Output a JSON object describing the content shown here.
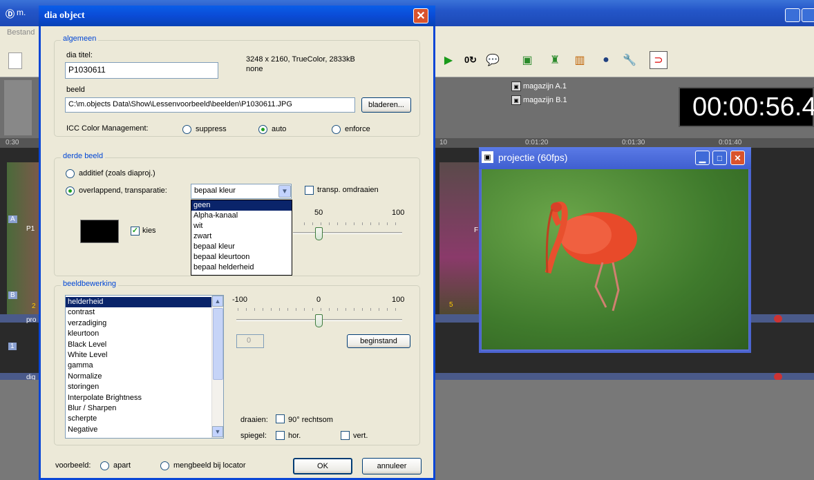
{
  "app": {
    "title": "m.",
    "menu_first": "Bestand",
    "timecode": "00:00:56.48",
    "magazines": [
      "magazijn A.1",
      "magazijn B.1"
    ],
    "ruler_labels": [
      "0:30",
      "10",
      "0:01:20",
      "0:01:30",
      "0:01:40"
    ],
    "track_labels": [
      "A",
      "B",
      "1"
    ],
    "track_texts": [
      "P1",
      "pro",
      "dig",
      "2",
      "5",
      "F"
    ]
  },
  "dialog": {
    "title": "dia object",
    "algemeen": {
      "legend": "algemeen",
      "dia_titel_label": "dia titel:",
      "dia_titel_value": "P1030611",
      "image_info": "3248 x 2160, TrueColor, 2833kB",
      "image_info2": "none",
      "beeld_label": "beeld",
      "beeld_path": "C:\\m.objects Data\\Show\\Lessenvoorbeeld\\beelden\\P1030611.JPG",
      "browse_label": "bladeren...",
      "icc_label": "ICC Color Management:",
      "icc_options": [
        "suppress",
        "auto",
        "enforce"
      ],
      "icc_selected": "auto"
    },
    "derde_beeld": {
      "legend": "derde beeld",
      "option1": "additief (zoals diaproj.)",
      "option2": "overlappend, transparatie:",
      "dropdown_value": "bepaal kleur",
      "dropdown_options": [
        "geen",
        "Alpha-kanaal",
        "wit",
        "zwart",
        "bepaal kleur",
        "bepaal kleurtoon",
        "bepaal helderheid"
      ],
      "dropdown_highlight": "geen",
      "transp_label": "transp. omdraaien",
      "kies_label": "kies",
      "swatch_color": "#000000",
      "slider_mid": "50",
      "slider_max": "100",
      "slider_value": 50
    },
    "beeldbewerking": {
      "legend": "beeldbewerking",
      "items": [
        "helderheid",
        "contrast",
        "verzadiging",
        "kleurtoon",
        "Black Level",
        "White Level",
        "gamma",
        "Normalize",
        "storingen",
        "Interpolate Brightness",
        "Blur / Sharpen",
        "scherpte",
        "Negative"
      ],
      "selected": "helderheid",
      "slider_min": "-100",
      "slider_mid": "0",
      "slider_max": "100",
      "value_field": "0",
      "reset_label": "beginstand",
      "draaien_label": "draaien:",
      "rotate_label": "90° rechtsom",
      "spiegel_label": "spiegel:",
      "hor_label": "hor.",
      "vert_label": "vert."
    },
    "footer": {
      "voorbeeld_label": "voorbeeld:",
      "apart_label": "apart",
      "mengbeeld_label": "mengbeeld bij locator",
      "ok_label": "OK",
      "cancel_label": "annuleer"
    }
  },
  "projection": {
    "title": "projectie (60fps)"
  },
  "colors": {
    "xp_blue": "#0a4bd6",
    "dialog_bg": "#ece9d8",
    "legend_blue": "#0046d5",
    "selection": "#0a246a"
  }
}
